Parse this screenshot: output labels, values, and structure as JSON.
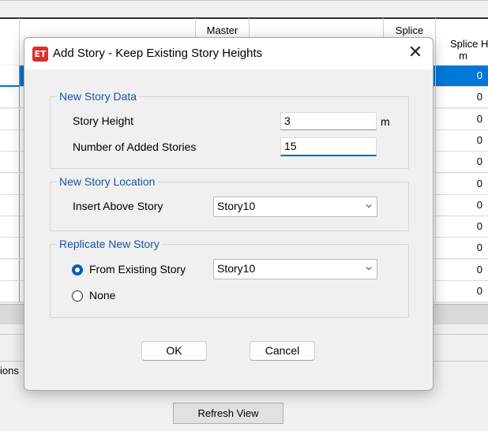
{
  "background_table": {
    "headers": {
      "master_label": "Master",
      "splice_label": "Splice",
      "splice_height_label": "Splice H",
      "splice_height_unit": "m"
    },
    "splice_height_values": [
      "0",
      "0",
      "0",
      "0",
      "0",
      "0",
      "0",
      "0",
      "0",
      "0",
      "0"
    ],
    "left_footer_text": "ions",
    "refresh_button": "Refresh View"
  },
  "dialog": {
    "icon_text": "ET",
    "title": "Add Story - Keep Existing Story Heights",
    "close_glyph": "✕",
    "new_story_data": {
      "title": "New Story Data",
      "story_height_label": "Story Height",
      "story_height_value": "3",
      "story_height_unit": "m",
      "added_stories_label": "Number of Added Stories",
      "added_stories_value": "15"
    },
    "new_story_location": {
      "title": "New Story Location",
      "insert_above_label": "Insert Above Story",
      "insert_above_value": "Story10"
    },
    "replicate_new_story": {
      "title": "Replicate New Story",
      "from_existing_label": "From Existing Story",
      "from_existing_checked": true,
      "from_existing_value": "Story10",
      "none_label": "None",
      "none_checked": false
    },
    "ok_label": "OK",
    "cancel_label": "Cancel"
  },
  "colors": {
    "selection": "#0078d7",
    "group_title": "#1d52a1",
    "radio_checked": "#005fb8",
    "app_icon": "#d8312e"
  }
}
